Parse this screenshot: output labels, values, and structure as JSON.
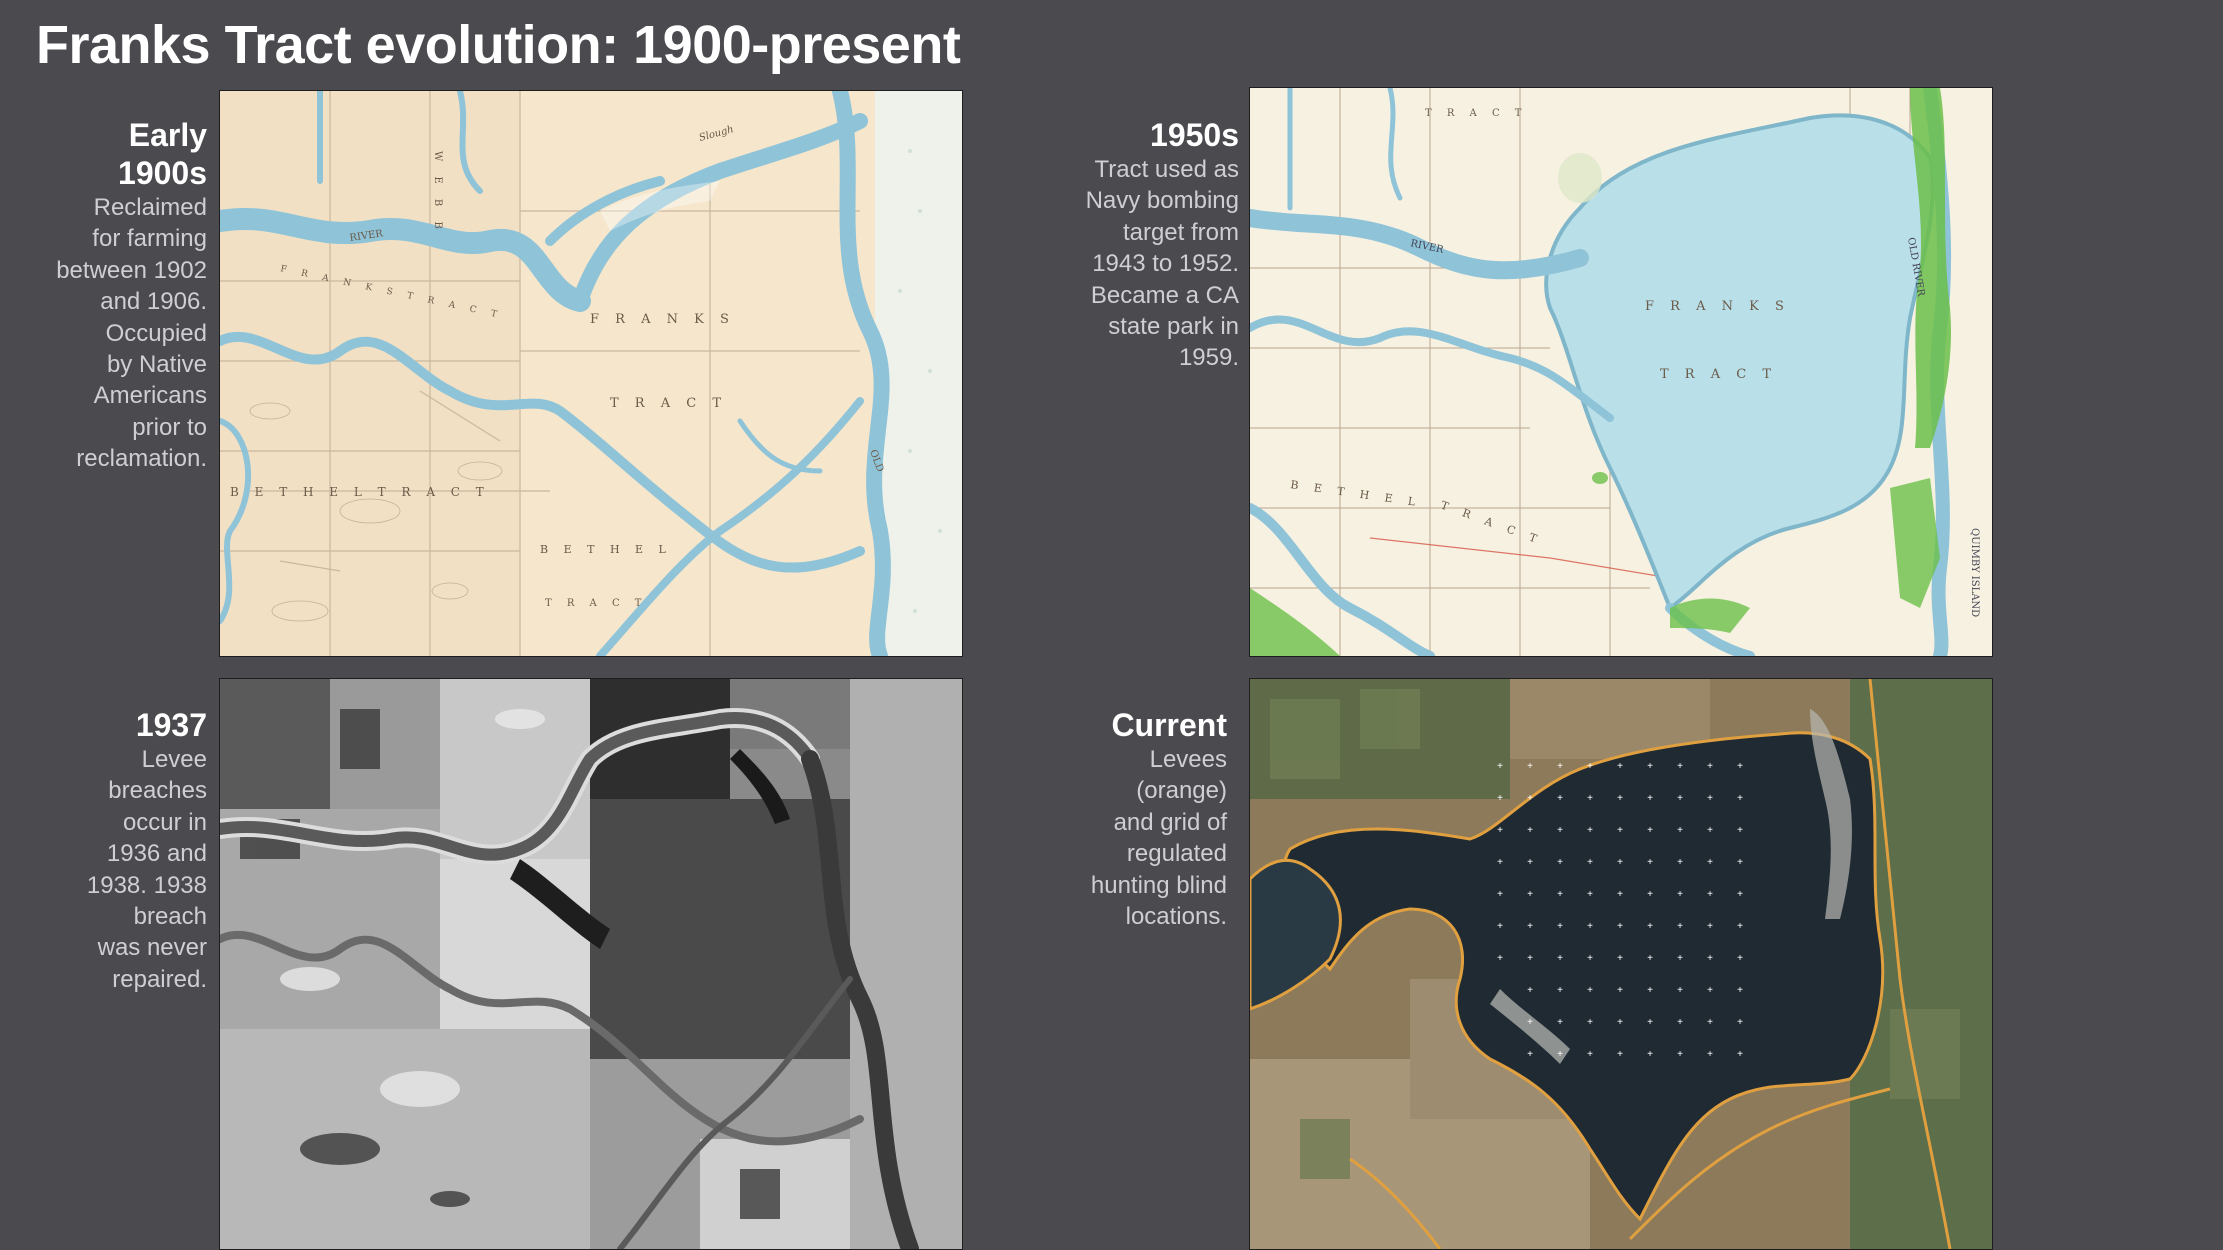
{
  "slide": {
    "title": "Franks Tract evolution: 1900-present"
  },
  "panels": [
    {
      "id": "early-1900s",
      "heading_line1": "Early",
      "heading_line2": "1900s",
      "body_lines": [
        "Reclaimed",
        "for farming",
        "between 1902",
        "and 1906.",
        "Occupied",
        "by Native",
        "Americans",
        "prior to",
        "reclamation."
      ],
      "map_labels": {
        "franks": "F R A N K S",
        "tract": "T R A C T",
        "bethel_tract": "B E T H E L   T R A C T",
        "bethel": "B E T H E L",
        "tract_small": "T R A C T",
        "webb": "W E B B",
        "franks_tract_small": "F R A N K S   T R A C T",
        "river": "RIVER",
        "slough": "Slough",
        "old_river": "OLD"
      }
    },
    {
      "id": "1950s",
      "heading_line1": "1950s",
      "body_lines": [
        "Tract used as",
        "Navy bombing",
        "target from",
        "1943 to 1952.",
        "Became a CA",
        "state park in",
        "1959."
      ],
      "map_labels": {
        "franks": "F R A N K S",
        "tract": "T R A C T",
        "bethel": "B E T H E L",
        "tract2": "T R A C T",
        "tract_top": "T R A C T",
        "river": "RIVER",
        "quimby_island": "QUIMBY ISLAND",
        "old_river": "OLD RIVER"
      }
    },
    {
      "id": "1937",
      "heading_line1": "1937",
      "body_lines": [
        "Levee",
        "breaches",
        "occur in",
        "1936 and",
        "1938. 1938",
        "breach",
        "was never",
        "repaired."
      ]
    },
    {
      "id": "current",
      "heading_line1": "Current",
      "body_lines": [
        "Levees",
        "(orange)",
        "and grid of",
        "regulated",
        "hunting blind",
        "locations."
      ]
    }
  ],
  "colors": {
    "background": "#4a4a4f",
    "levee": "#e0a040",
    "water_old": "#8fc3d8",
    "parchment": "#f5e6cc",
    "water_1950s": "#b9dfe9",
    "marsh_green": "#6cc04a"
  }
}
